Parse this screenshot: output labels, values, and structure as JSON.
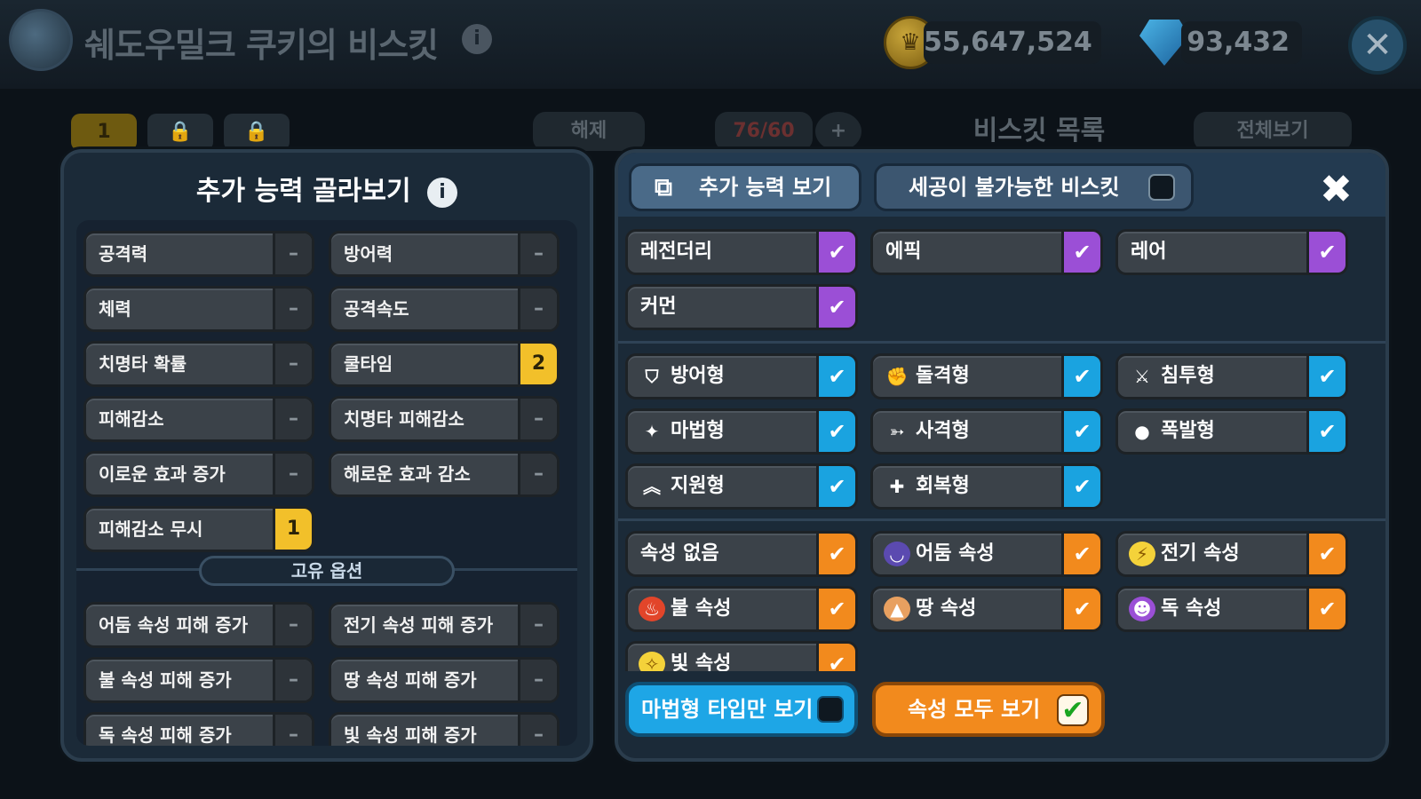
{
  "header": {
    "title": "쉐도우밀크 쿠키의 비스킷",
    "gold": "55,647,524",
    "gems": "93,432"
  },
  "background": {
    "slot_number": "1",
    "unequip_label": "해제",
    "count": "76/60",
    "plus": "+",
    "list_title": "비스킷 목록",
    "view_all_label": "전체보기"
  },
  "left_panel": {
    "title": "추가 능력 골라보기",
    "options": [
      {
        "label": "공격력",
        "count": "–"
      },
      {
        "label": "방어력",
        "count": "–"
      },
      {
        "label": "체력",
        "count": "–"
      },
      {
        "label": "공격속도",
        "count": "–"
      },
      {
        "label": "치명타 확률",
        "count": "–"
      },
      {
        "label": "쿨타임",
        "count": "2"
      },
      {
        "label": "피해감소",
        "count": "–"
      },
      {
        "label": "치명타 피해감소",
        "count": "–"
      },
      {
        "label": "이로운 효과 증가",
        "count": "–"
      },
      {
        "label": "해로운 효과 감소",
        "count": "–"
      },
      {
        "label": "피해감소 무시",
        "count": "1"
      }
    ],
    "unique_label": "고유 옵션",
    "unique_options": [
      {
        "label": "어둠 속성 피해 증가",
        "count": "–"
      },
      {
        "label": "전기 속성 피해 증가",
        "count": "–"
      },
      {
        "label": "불 속성 피해 증가",
        "count": "–"
      },
      {
        "label": "땅 속성 피해 증가",
        "count": "–"
      },
      {
        "label": "독 속성 피해 증가",
        "count": "–"
      },
      {
        "label": "빛 속성 피해 증가",
        "count": "–"
      }
    ]
  },
  "right_panel": {
    "tab_ability": "추가 능력 보기",
    "tab_nocraft": "세공이 불가능한 비스킷",
    "rarity": [
      "레전더리",
      "에픽",
      "레어",
      "커먼"
    ],
    "types": [
      "방어형",
      "돌격형",
      "침투형",
      "마법형",
      "사격형",
      "폭발형",
      "지원형",
      "회복형"
    ],
    "attributes": [
      "속성 없음",
      "어둠 속성",
      "전기 속성",
      "불 속성",
      "땅 속성",
      "독 속성",
      "빛 속성"
    ],
    "btn_magic_only": "마법형 타입만 보기",
    "btn_all_attr": "속성 모두 보기",
    "check_mark": "✔",
    "colors": {
      "rarity": "#9b4fd6",
      "type": "#1aa3e0",
      "attribute": "#f28a1d",
      "counter_active": "#f2c02a"
    }
  }
}
